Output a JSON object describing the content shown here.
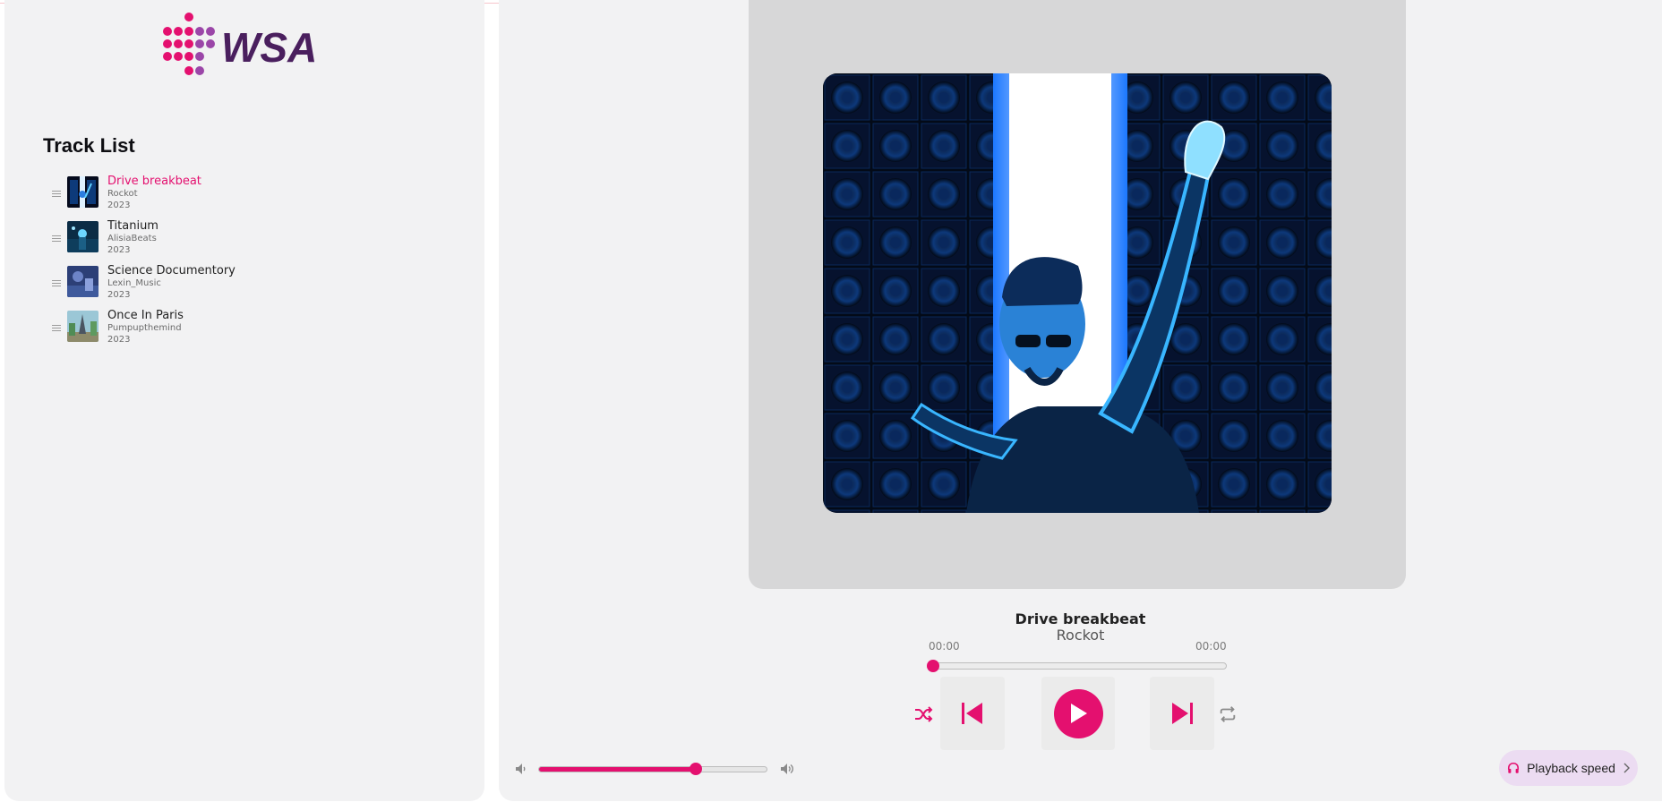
{
  "brand": {
    "name": "WSA",
    "colors": {
      "dots_pink": "#e4106f",
      "dots_purple": "#9b46a8",
      "text": "#4a1f5e"
    }
  },
  "sidebar": {
    "title": "Track List",
    "tracks": [
      {
        "title": "Drive breakbeat",
        "artist": "Rockot",
        "year": "2023",
        "active": true
      },
      {
        "title": "Titanium",
        "artist": "AlisiaBeats",
        "year": "2023",
        "active": false
      },
      {
        "title": "Science Documentory",
        "artist": "Lexin_Music",
        "year": "2023",
        "active": false
      },
      {
        "title": "Once In Paris",
        "artist": "Pumpupthemind",
        "year": "2023",
        "active": false
      }
    ]
  },
  "player": {
    "now_playing": {
      "title": "Drive breakbeat",
      "artist": "Rockot"
    },
    "time_current": "00:00",
    "time_total": "00:00",
    "progress": 0,
    "volume": 0.69,
    "playback_speed_label": "Playback speed",
    "accent_color": "#e4106f",
    "icons": {
      "shuffle": "shuffle-icon",
      "previous": "skip-previous-icon",
      "play": "play-icon",
      "next": "skip-next-icon",
      "repeat": "repeat-icon",
      "volume_low": "volume-low-icon",
      "volume_high": "volume-high-icon",
      "speed": "headphones-icon"
    }
  }
}
